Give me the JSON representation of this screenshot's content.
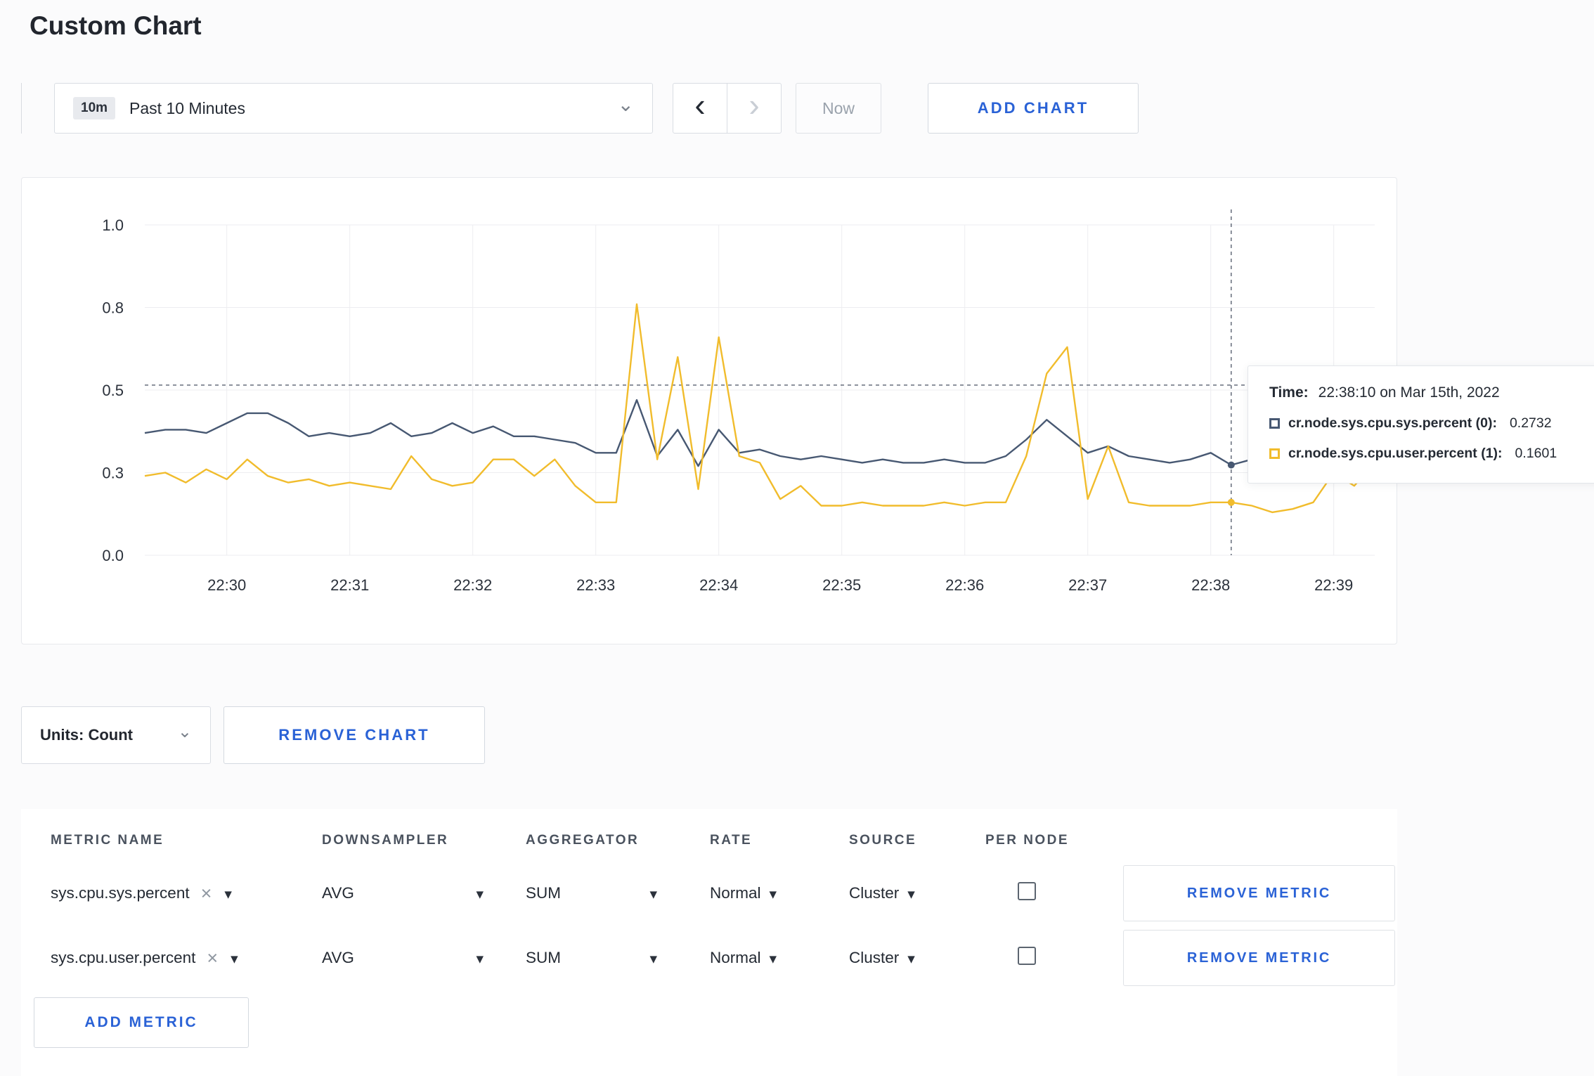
{
  "page": {
    "title": "Custom Chart"
  },
  "icons": {
    "chevron_down": "⌄",
    "chevron_left": "‹",
    "chevron_right": "›",
    "caret_down": "▾",
    "close": "×"
  },
  "toolbar": {
    "range_badge": "10m",
    "range_label": "Past 10 Minutes",
    "now_label": "Now",
    "add_chart_label": "ADD CHART"
  },
  "chart_controls": {
    "units_label": "Units: Count",
    "remove_chart_label": "REMOVE CHART"
  },
  "tooltip": {
    "time_label": "Time:",
    "time_value": "22:38:10 on Mar 15th, 2022",
    "rows": [
      {
        "name": "cr.node.sys.cpu.sys.percent (0):",
        "value": "0.2732",
        "color": "#475872"
      },
      {
        "name": "cr.node.sys.cpu.user.percent (1):",
        "value": "0.1601",
        "color": "#f1bc2c"
      }
    ]
  },
  "chart_data": {
    "type": "line",
    "title": "",
    "xlabel": "",
    "ylabel": "",
    "x_start": "22:29:20",
    "sample_interval_seconds": 10,
    "x_total_seconds": 600,
    "y_domain": [
      0,
      1
    ],
    "grid": true,
    "legend_position": "none",
    "y_ticks": [
      {
        "value": 0.0,
        "label": "0.0"
      },
      {
        "value": 0.25,
        "label": "0.3"
      },
      {
        "value": 0.5,
        "label": "0.5"
      },
      {
        "value": 0.75,
        "label": "0.8"
      },
      {
        "value": 1.0,
        "label": "1.0"
      }
    ],
    "x_ticks": [
      {
        "label": "22:30",
        "offset_seconds": 40
      },
      {
        "label": "22:31",
        "offset_seconds": 100
      },
      {
        "label": "22:32",
        "offset_seconds": 160
      },
      {
        "label": "22:33",
        "offset_seconds": 220
      },
      {
        "label": "22:34",
        "offset_seconds": 280
      },
      {
        "label": "22:35",
        "offset_seconds": 340
      },
      {
        "label": "22:36",
        "offset_seconds": 400
      },
      {
        "label": "22:37",
        "offset_seconds": 460
      },
      {
        "label": "22:38",
        "offset_seconds": 520
      },
      {
        "label": "22:39",
        "offset_seconds": 580
      }
    ],
    "series": [
      {
        "name": "cr.node.sys.cpu.sys.percent",
        "color": "#475872",
        "values": [
          0.37,
          0.38,
          0.38,
          0.37,
          0.4,
          0.43,
          0.43,
          0.4,
          0.36,
          0.37,
          0.36,
          0.37,
          0.4,
          0.36,
          0.37,
          0.4,
          0.37,
          0.39,
          0.36,
          0.36,
          0.35,
          0.34,
          0.31,
          0.31,
          0.47,
          0.3,
          0.38,
          0.27,
          0.38,
          0.31,
          0.32,
          0.3,
          0.29,
          0.3,
          0.29,
          0.28,
          0.29,
          0.28,
          0.28,
          0.29,
          0.28,
          0.28,
          0.3,
          0.35,
          0.41,
          0.36,
          0.31,
          0.33,
          0.3,
          0.29,
          0.28,
          0.29,
          0.31,
          0.2732,
          0.29,
          0.28,
          0.29,
          0.31,
          0.3,
          0.3,
          0.31
        ]
      },
      {
        "name": "cr.node.sys.cpu.user.percent",
        "color": "#f1bc2c",
        "values": [
          0.24,
          0.25,
          0.22,
          0.26,
          0.23,
          0.29,
          0.24,
          0.22,
          0.23,
          0.21,
          0.22,
          0.21,
          0.2,
          0.3,
          0.23,
          0.21,
          0.22,
          0.29,
          0.29,
          0.24,
          0.29,
          0.21,
          0.16,
          0.16,
          0.76,
          0.29,
          0.6,
          0.2,
          0.66,
          0.3,
          0.28,
          0.17,
          0.21,
          0.15,
          0.15,
          0.16,
          0.15,
          0.15,
          0.15,
          0.16,
          0.15,
          0.16,
          0.16,
          0.3,
          0.55,
          0.63,
          0.17,
          0.33,
          0.16,
          0.15,
          0.15,
          0.15,
          0.16,
          0.1601,
          0.15,
          0.13,
          0.14,
          0.16,
          0.25,
          0.21,
          0.28
        ]
      }
    ],
    "crosshair": {
      "time": "22:38:10",
      "x_offset_seconds": 530,
      "index": 53,
      "hline_value": 0.515
    }
  },
  "metrics_table": {
    "headers": [
      "METRIC NAME",
      "DOWNSAMPLER",
      "AGGREGATOR",
      "RATE",
      "SOURCE",
      "PER NODE"
    ],
    "rows": [
      {
        "metric": "sys.cpu.sys.percent",
        "downsampler": "AVG",
        "aggregator": "SUM",
        "rate": "Normal",
        "source": "Cluster",
        "per_node_checked": false,
        "remove_label": "REMOVE METRIC"
      },
      {
        "metric": "sys.cpu.user.percent",
        "downsampler": "AVG",
        "aggregator": "SUM",
        "rate": "Normal",
        "source": "Cluster",
        "per_node_checked": false,
        "remove_label": "REMOVE METRIC"
      }
    ],
    "add_metric_label": "ADD METRIC"
  }
}
